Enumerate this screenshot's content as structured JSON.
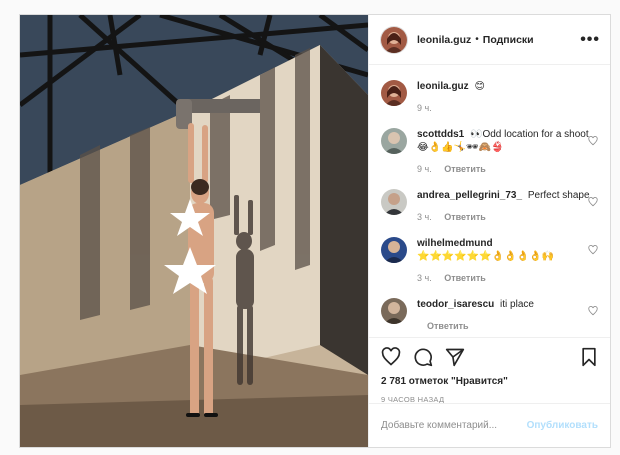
{
  "header": {
    "username": "leonila.guz",
    "separator": "•",
    "follow_label": "Подписки",
    "more_icon": "more-horizontal-icon"
  },
  "caption": {
    "username": "leonila.guz",
    "text": "😊",
    "time": "9 ч."
  },
  "comments": [
    {
      "username": "scottdds1",
      "text": "👀Odd location for a shoot 😂👌👍🤸🕶🙈👙",
      "time": "9 ч.",
      "reply_label": "Ответить"
    },
    {
      "username": "andrea_pellegrini_73_",
      "text": "Perfect shape",
      "time": "3 ч.",
      "reply_label": "Ответить"
    },
    {
      "username": "wilhelmedmund",
      "text": "⭐⭐⭐⭐⭐⭐👌👌👌👌🙌",
      "time": "3 ч.",
      "reply_label": "Ответить"
    },
    {
      "username": "teodor_isarescu",
      "text": "iti place",
      "time": "",
      "reply_label": "Ответить"
    }
  ],
  "actions": {
    "likes": "2 781 отметок \"Нравится\"",
    "timestamp": "9 ЧАСОВ НАЗАД"
  },
  "add_comment": {
    "placeholder": "Добавьте комментарий...",
    "post_label": "Опубликовать"
  },
  "colors": {
    "link_disabled": "#b2dffc",
    "muted": "#8e8e8e",
    "border": "#dbdbdb"
  }
}
